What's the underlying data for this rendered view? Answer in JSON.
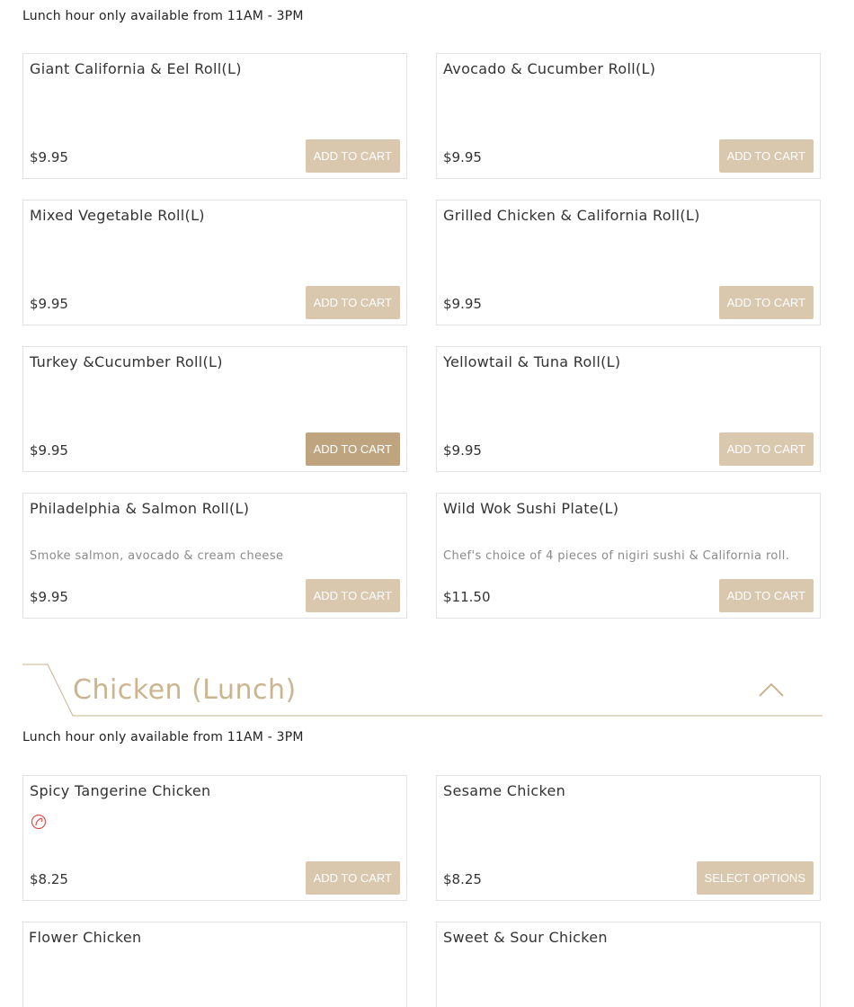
{
  "lunch_note_top": "Lunch hour only available from 11AM - 3PM",
  "sushi_items": [
    {
      "name": "Giant California & Eel Roll(L)",
      "desc": "",
      "price": "$9.95",
      "button": "ADD TO CART"
    },
    {
      "name": "Avocado & Cucumber Roll(L)",
      "desc": "",
      "price": "$9.95",
      "button": "ADD TO CART"
    },
    {
      "name": "Mixed Vegetable Roll(L)",
      "desc": "",
      "price": "$9.95",
      "button": "ADD TO CART"
    },
    {
      "name": "Grilled Chicken & California Roll(L)",
      "desc": "",
      "price": "$9.95",
      "button": "ADD TO CART"
    },
    {
      "name": "Turkey &Cucumber Roll(L)",
      "desc": "",
      "price": "$9.95",
      "button": "ADD TO CART"
    },
    {
      "name": "Yellowtail & Tuna Roll(L)",
      "desc": "",
      "price": "$9.95",
      "button": "ADD TO CART"
    },
    {
      "name": "Philadelphia & Salmon Roll(L)",
      "desc": "Smoke salmon, avocado & cream cheese",
      "price": "$9.95",
      "button": "ADD TO CART"
    },
    {
      "name": "Wild Wok Sushi Plate(L)",
      "desc": "Chef's choice of 4 pieces of nigiri sushi & California roll.",
      "price": "$11.50",
      "button": "ADD TO CART"
    }
  ],
  "chicken_section": {
    "title": "Chicken (Lunch)",
    "note": "Lunch hour only available from 11AM - 3PM",
    "items": [
      {
        "name": "Spicy Tangerine Chicken",
        "price": "$8.25",
        "button": "ADD TO CART",
        "icon": "spicy-icon"
      },
      {
        "name": "Sesame Chicken",
        "price": "$8.25",
        "button": "SELECT OPTIONS"
      },
      {
        "name": "Flower Chicken"
      },
      {
        "name": "Sweet & Sour Chicken"
      }
    ]
  },
  "colors": {
    "button": "#d9c8ad",
    "button_hover": "#bea57f",
    "section_title": "#cbb48e",
    "spicy": "#e05050"
  }
}
